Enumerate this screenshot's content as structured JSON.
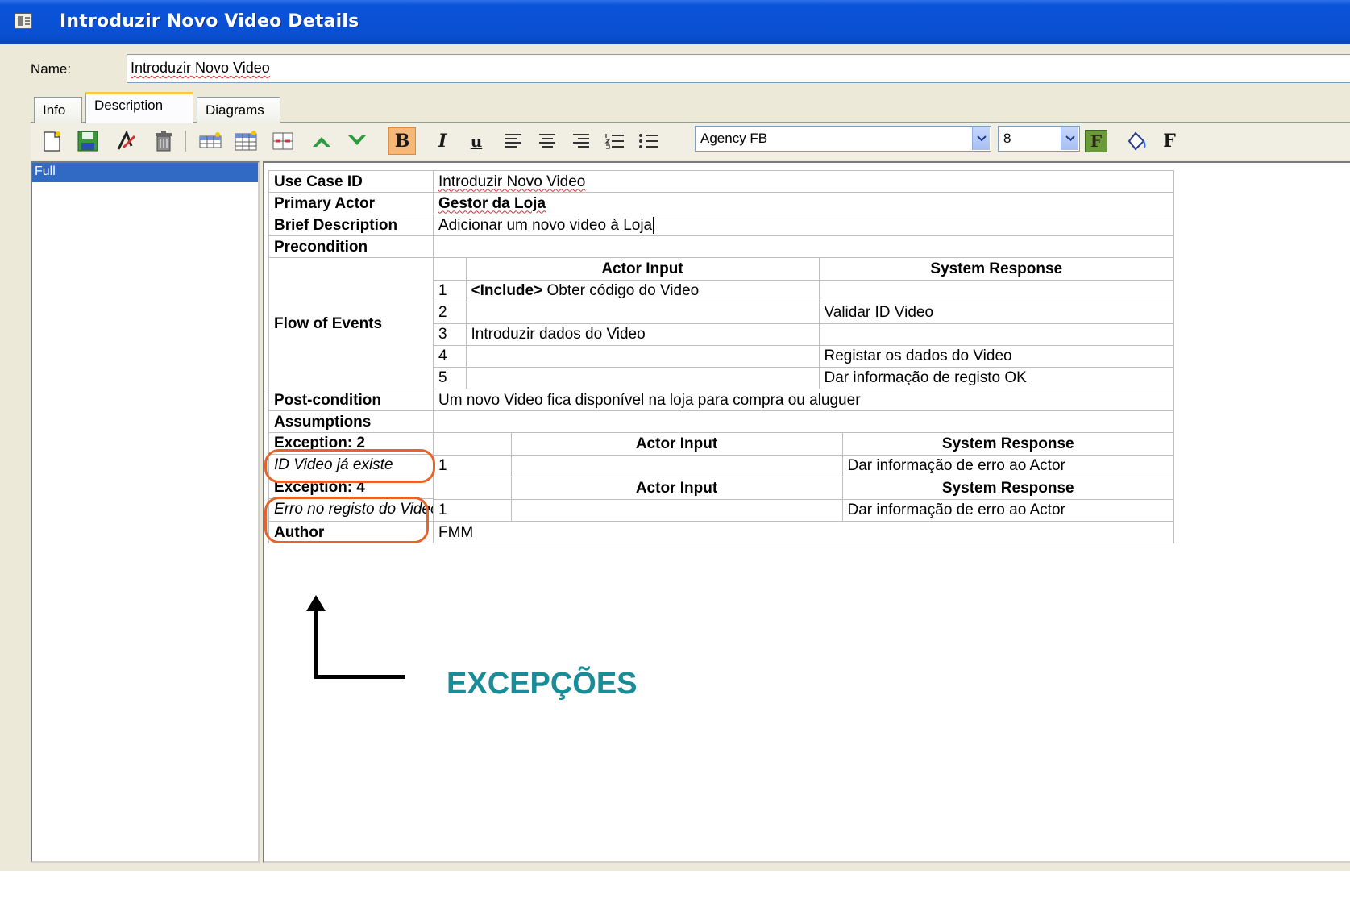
{
  "window": {
    "title": "Introduzir Novo Video Details"
  },
  "name_field": {
    "label": "Name:",
    "value": "Introduzir Novo Video"
  },
  "tabs": [
    {
      "label": "Info",
      "active": false
    },
    {
      "label": "Description",
      "active": true
    },
    {
      "label": "Diagrams",
      "active": false
    }
  ],
  "toolbar": {
    "icons": [
      "new-doc-icon",
      "save-icon",
      "spell-check-icon",
      "delete-icon",
      "insert-row-icon",
      "insert-table-icon",
      "split-cells-icon",
      "move-up-icon",
      "move-down-icon",
      "bold-icon",
      "italic-icon",
      "underline-icon",
      "align-left-icon",
      "align-center-icon",
      "align-right-icon",
      "numbered-list-icon",
      "bullet-list-icon",
      "font-color-icon",
      "fill-color-icon",
      "font-icon"
    ],
    "bold_glyph": "B",
    "italic_glyph": "I",
    "underline_glyph": "u",
    "font_glyph": "F",
    "font_color_glyph": "F",
    "font_name": "Agency FB",
    "font_size": "8"
  },
  "left_panel": {
    "selected_item": "Full"
  },
  "use_case": {
    "use_case_id": {
      "label": "Use Case ID",
      "value": "Introduzir Novo Video"
    },
    "primary_actor": {
      "label": "Primary Actor",
      "value": "Gestor da Loja"
    },
    "brief_description": {
      "label": "Brief Description",
      "value": "Adicionar um novo video à Loja"
    },
    "precondition": {
      "label": "Precondition",
      "value": ""
    },
    "flow_of_events": {
      "label": "Flow of Events",
      "header_actor": "Actor Input",
      "header_system": "System Response",
      "steps": [
        {
          "n": "1",
          "actor_tag": "<Include>",
          "actor": " Obter código do Video",
          "system": ""
        },
        {
          "n": "2",
          "actor_tag": "",
          "actor": "",
          "system": "Validar ID Video"
        },
        {
          "n": "3",
          "actor_tag": "",
          "actor": "Introduzir dados do Video",
          "system": ""
        },
        {
          "n": "4",
          "actor_tag": "",
          "actor": "",
          "system": "Registar os dados do Video"
        },
        {
          "n": "5",
          "actor_tag": "",
          "actor": "",
          "system": "Dar informação de registo OK"
        }
      ]
    },
    "post_condition": {
      "label": "Post-condition",
      "value": "Um novo Video fica disponível na loja para compra ou aluguer"
    },
    "assumptions": {
      "label": "Assumptions",
      "value": ""
    },
    "exceptions": [
      {
        "label": "Exception: 2",
        "description": "ID Video já existe",
        "header_actor": "Actor Input",
        "header_system": "System Response",
        "n": "1",
        "actor": "",
        "system": "Dar informação de erro ao Actor"
      },
      {
        "label": "Exception: 4",
        "description": "Erro no registo do Video",
        "header_actor": "Actor Input",
        "header_system": "System Response",
        "n": "1",
        "actor": "",
        "system": "Dar informação de erro ao Actor"
      }
    ],
    "author": {
      "label": "Author",
      "value": "FMM"
    }
  },
  "annotation": {
    "text": "EXCEPÇÕES",
    "color": "#1a8c98",
    "highlight_color": "#e8632a"
  }
}
